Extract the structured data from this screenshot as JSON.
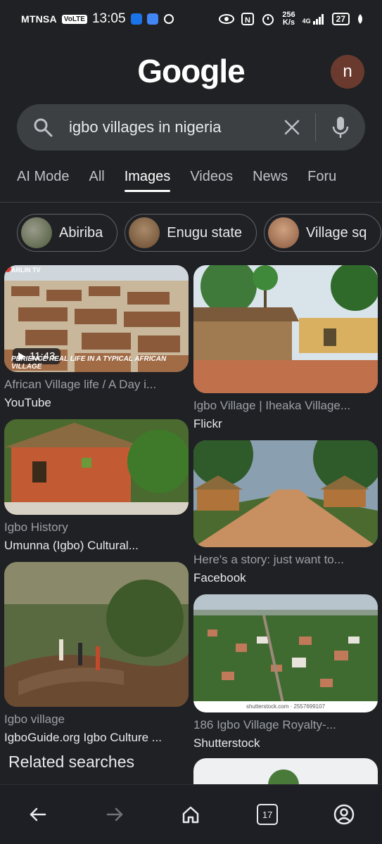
{
  "status_bar": {
    "carrier": "MTNSA",
    "volte": "VoLTE",
    "time": "13:05",
    "speed_value": "256",
    "speed_unit": "K/s",
    "network": "4G",
    "battery": "27"
  },
  "header": {
    "logo": "Google",
    "avatar_letter": "n"
  },
  "search": {
    "query": "igbo villages in nigeria"
  },
  "tabs": [
    {
      "label": "AI Mode",
      "active": false
    },
    {
      "label": "All",
      "active": false
    },
    {
      "label": "Images",
      "active": true
    },
    {
      "label": "Videos",
      "active": false
    },
    {
      "label": "News",
      "active": false
    },
    {
      "label": "Foru",
      "active": false
    }
  ],
  "chips": [
    {
      "label": "Abiriba"
    },
    {
      "label": "Enugu state"
    },
    {
      "label": "Village sq"
    }
  ],
  "results": [
    {
      "title": "African Village life / A Day i...",
      "source": "YouTube",
      "duration": "11:43",
      "channel_tag": "ARLIN TV",
      "caption": "PERIENCE REAL LIFE IN A TYPICAL AFRICAN VILLAGE"
    },
    {
      "title": "Igbo Village | Iheaka Village...",
      "source": "Flickr"
    },
    {
      "title": "Igbo History",
      "source": "Umunna (Igbo) Cultural..."
    },
    {
      "title": "Here's a story: just want to...",
      "source": "Facebook"
    },
    {
      "title": "Igbo village",
      "source": "IgboGuide.org Igbo Culture ..."
    },
    {
      "title": "186 Igbo Village Royalty-...",
      "source": "Shutterstock",
      "watermark": "shutterstock.com · 2557699107"
    }
  ],
  "related_searches_heading": "Related searches",
  "navigation": {
    "tab_count": "17"
  }
}
